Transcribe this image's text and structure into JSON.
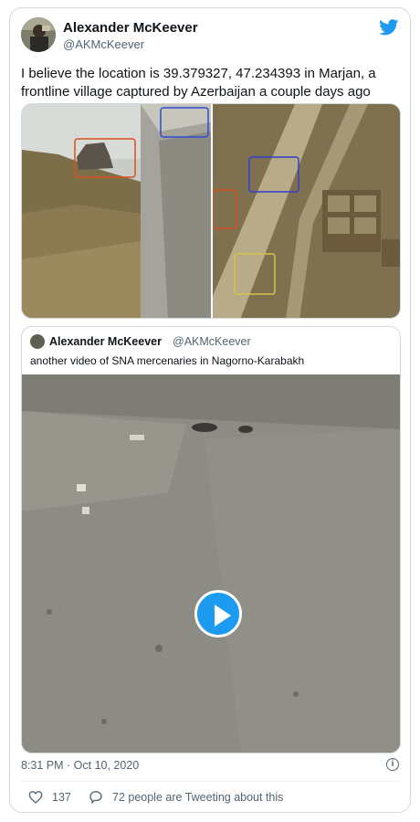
{
  "author": {
    "name": "Alexander McKeever",
    "handle": "@AKMcKeever"
  },
  "tweet": {
    "text": "I believe the location is 39.379327, 47.234393 in Marjan, a frontline village captured by Azerbaijan a couple days ago",
    "timestamp": "8:31 PM · Oct 10, 2020"
  },
  "quoted_tweet": {
    "name": "Alexander McKeever",
    "handle": "@AKMcKeever",
    "text": "another video of SNA mercenaries in Nagorno-Karabakh"
  },
  "engagement": {
    "likes": "137",
    "conversation": "72 people are Tweeting about this"
  },
  "colors": {
    "accent": "#1d9bf0",
    "secondary_text": "#536471",
    "border": "#cfd9de"
  },
  "icons": {
    "brand": "twitter-bird-icon",
    "play": "play-icon",
    "info": "info-icon",
    "like": "heart-icon",
    "comment": "speech-bubble-icon"
  }
}
